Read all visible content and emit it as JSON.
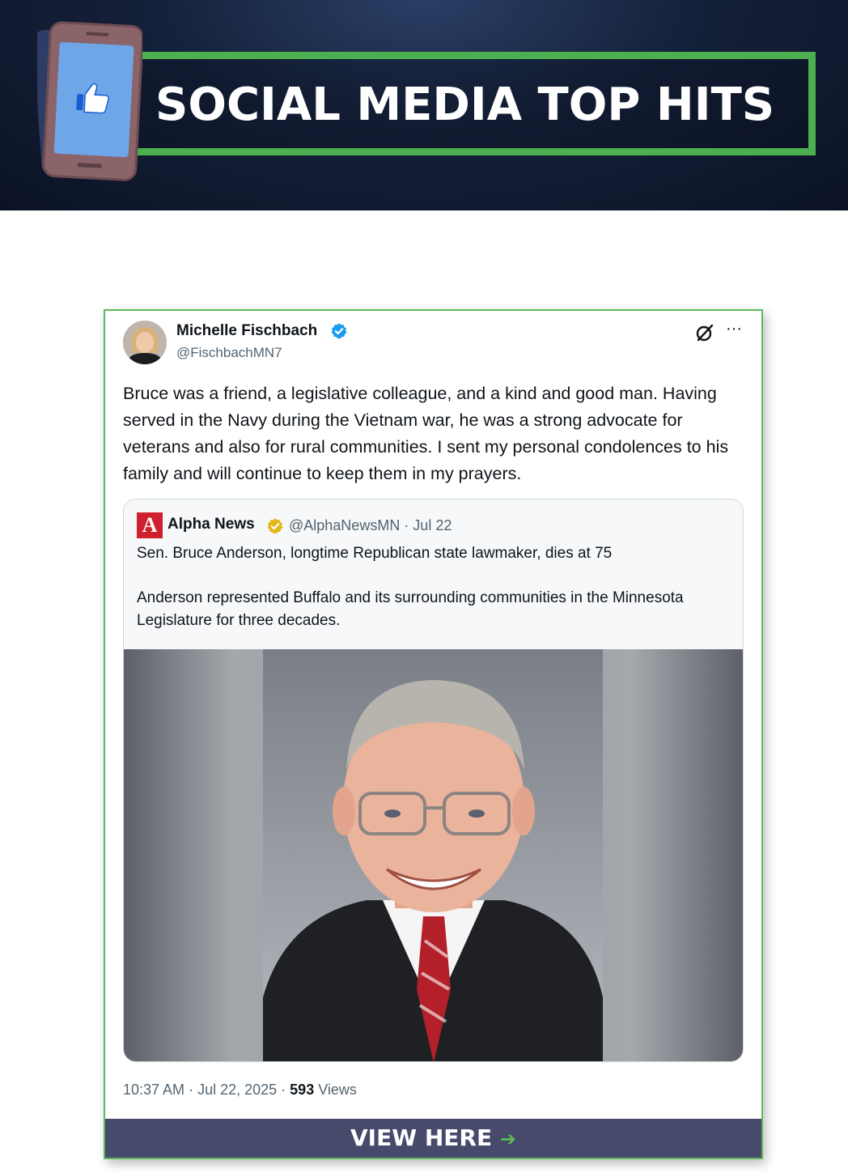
{
  "banner": {
    "title": "SOCIAL MEDIA TOP HITS",
    "icon": "phone-thumbs-up-icon",
    "frame_color": "#4caf50"
  },
  "tweet": {
    "author_name": "Michelle Fischbach",
    "handle": "@FischbachMN7",
    "text": "Bruce was a friend, a legislative colleague, and a kind and good man. Having served in the Navy during the Vietnam war, he was a strong advocate for veterans and also for rural communities. I sent my personal condolences to his family and will continue to keep them in my prayers.",
    "time": "10:37 AM",
    "date": "Jul 22, 2025",
    "views_count": "593",
    "views_label": "Views"
  },
  "quoted": {
    "logo_letter": "A",
    "name": "Alpha News",
    "meta": "@AlphaNewsMN · Jul 22",
    "headline": "Sen. Bruce Anderson, longtime Republican state lawmaker, dies at 75",
    "body": "Anderson represented Buffalo and its surrounding communities in the Minnesota Legislature for three decades."
  },
  "cta": {
    "label": "VIEW HERE",
    "arrow": "➔"
  },
  "colors": {
    "verified_blue": "#1d9bf0",
    "verified_gold": "#e2b719",
    "cta_bg": "#474a6b",
    "card_border": "#5cb85c"
  }
}
